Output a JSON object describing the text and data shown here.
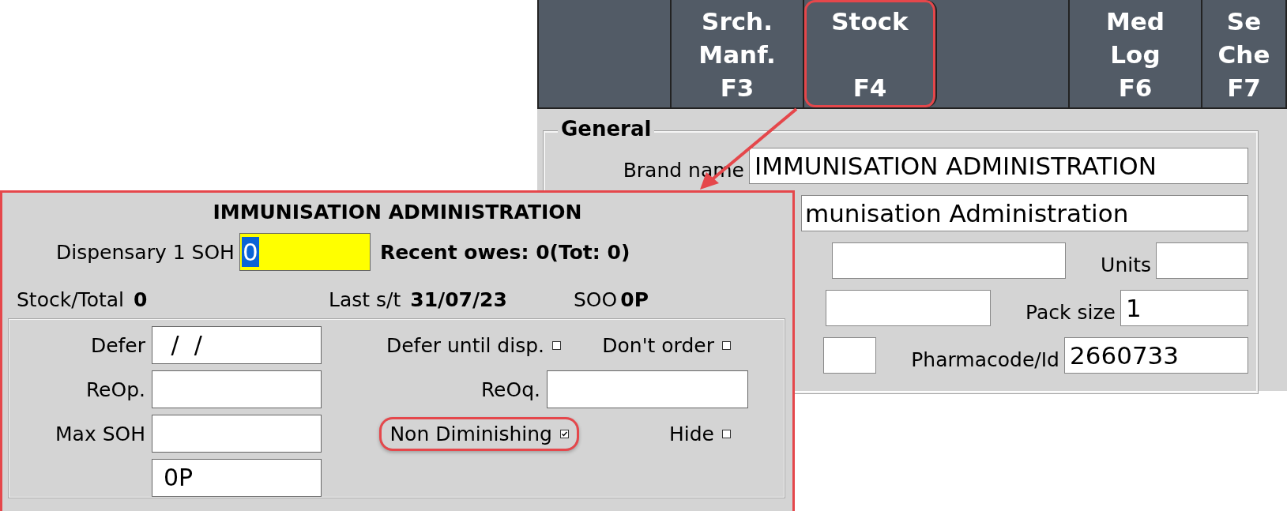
{
  "toolbar": [
    {
      "highlighted": false
    },
    {
      "lines": [
        "Srch.",
        "Manf."
      ],
      "key": "F3",
      "highlighted": false
    },
    {
      "lines": [
        "Stock"
      ],
      "key": "F4",
      "highlighted": true
    },
    {
      "highlighted": false
    },
    {
      "lines": [
        "Med",
        "Log"
      ],
      "key": "F6",
      "highlighted": false
    },
    {
      "lines": [
        "Se",
        "Che"
      ],
      "key": "F7",
      "highlighted": false
    }
  ],
  "general": {
    "title": "General",
    "rows": [
      {
        "label": "Brand name",
        "value": "IMMUNISATION ADMINISTRATION"
      },
      {
        "value": "munisation Administration"
      },
      {
        "side_label": "Units"
      },
      {
        "side_label": "Pack size",
        "side_value": "1"
      },
      {
        "side_label": "Pharmacode/Id",
        "side_value": "2660733"
      }
    ]
  },
  "stock_panel": {
    "title": "IMMUNISATION ADMINISTRATION",
    "soh_label": "Dispensary 1 SOH",
    "soh_value": "0",
    "soh_text_selected": true,
    "recent_owes": "Recent owes: 0(Tot: 0)",
    "stock_total_label": "Stock/Total",
    "stock_total_value": "0",
    "last_st_label": "Last s/t",
    "last_st_value": "31/07/23",
    "soo_label": "SOO",
    "soo_value": "0P",
    "rows": [
      {
        "cells": [
          {
            "kind": "field",
            "label": "Defer",
            "value": " /  /"
          },
          {
            "kind": "checkbox",
            "label": "Defer until disp.",
            "checked": false,
            "highlighted": false
          },
          {
            "kind": "checkbox",
            "label": "Don't order",
            "checked": false,
            "highlighted": false
          }
        ]
      },
      {
        "cells": [
          {
            "kind": "field",
            "label": "ReOp."
          },
          {
            "kind": "field",
            "label": "ReOq."
          }
        ]
      },
      {
        "cells": [
          {
            "kind": "field",
            "label": "Max SOH"
          },
          {
            "kind": "checkbox",
            "label": "Non Diminishing",
            "checked": true,
            "highlighted": true
          },
          {
            "kind": "checkbox",
            "label": "Hide",
            "checked": false,
            "highlighted": false
          }
        ]
      },
      {
        "cells": [
          {
            "kind": "field",
            "value": "0P"
          }
        ]
      }
    ]
  }
}
